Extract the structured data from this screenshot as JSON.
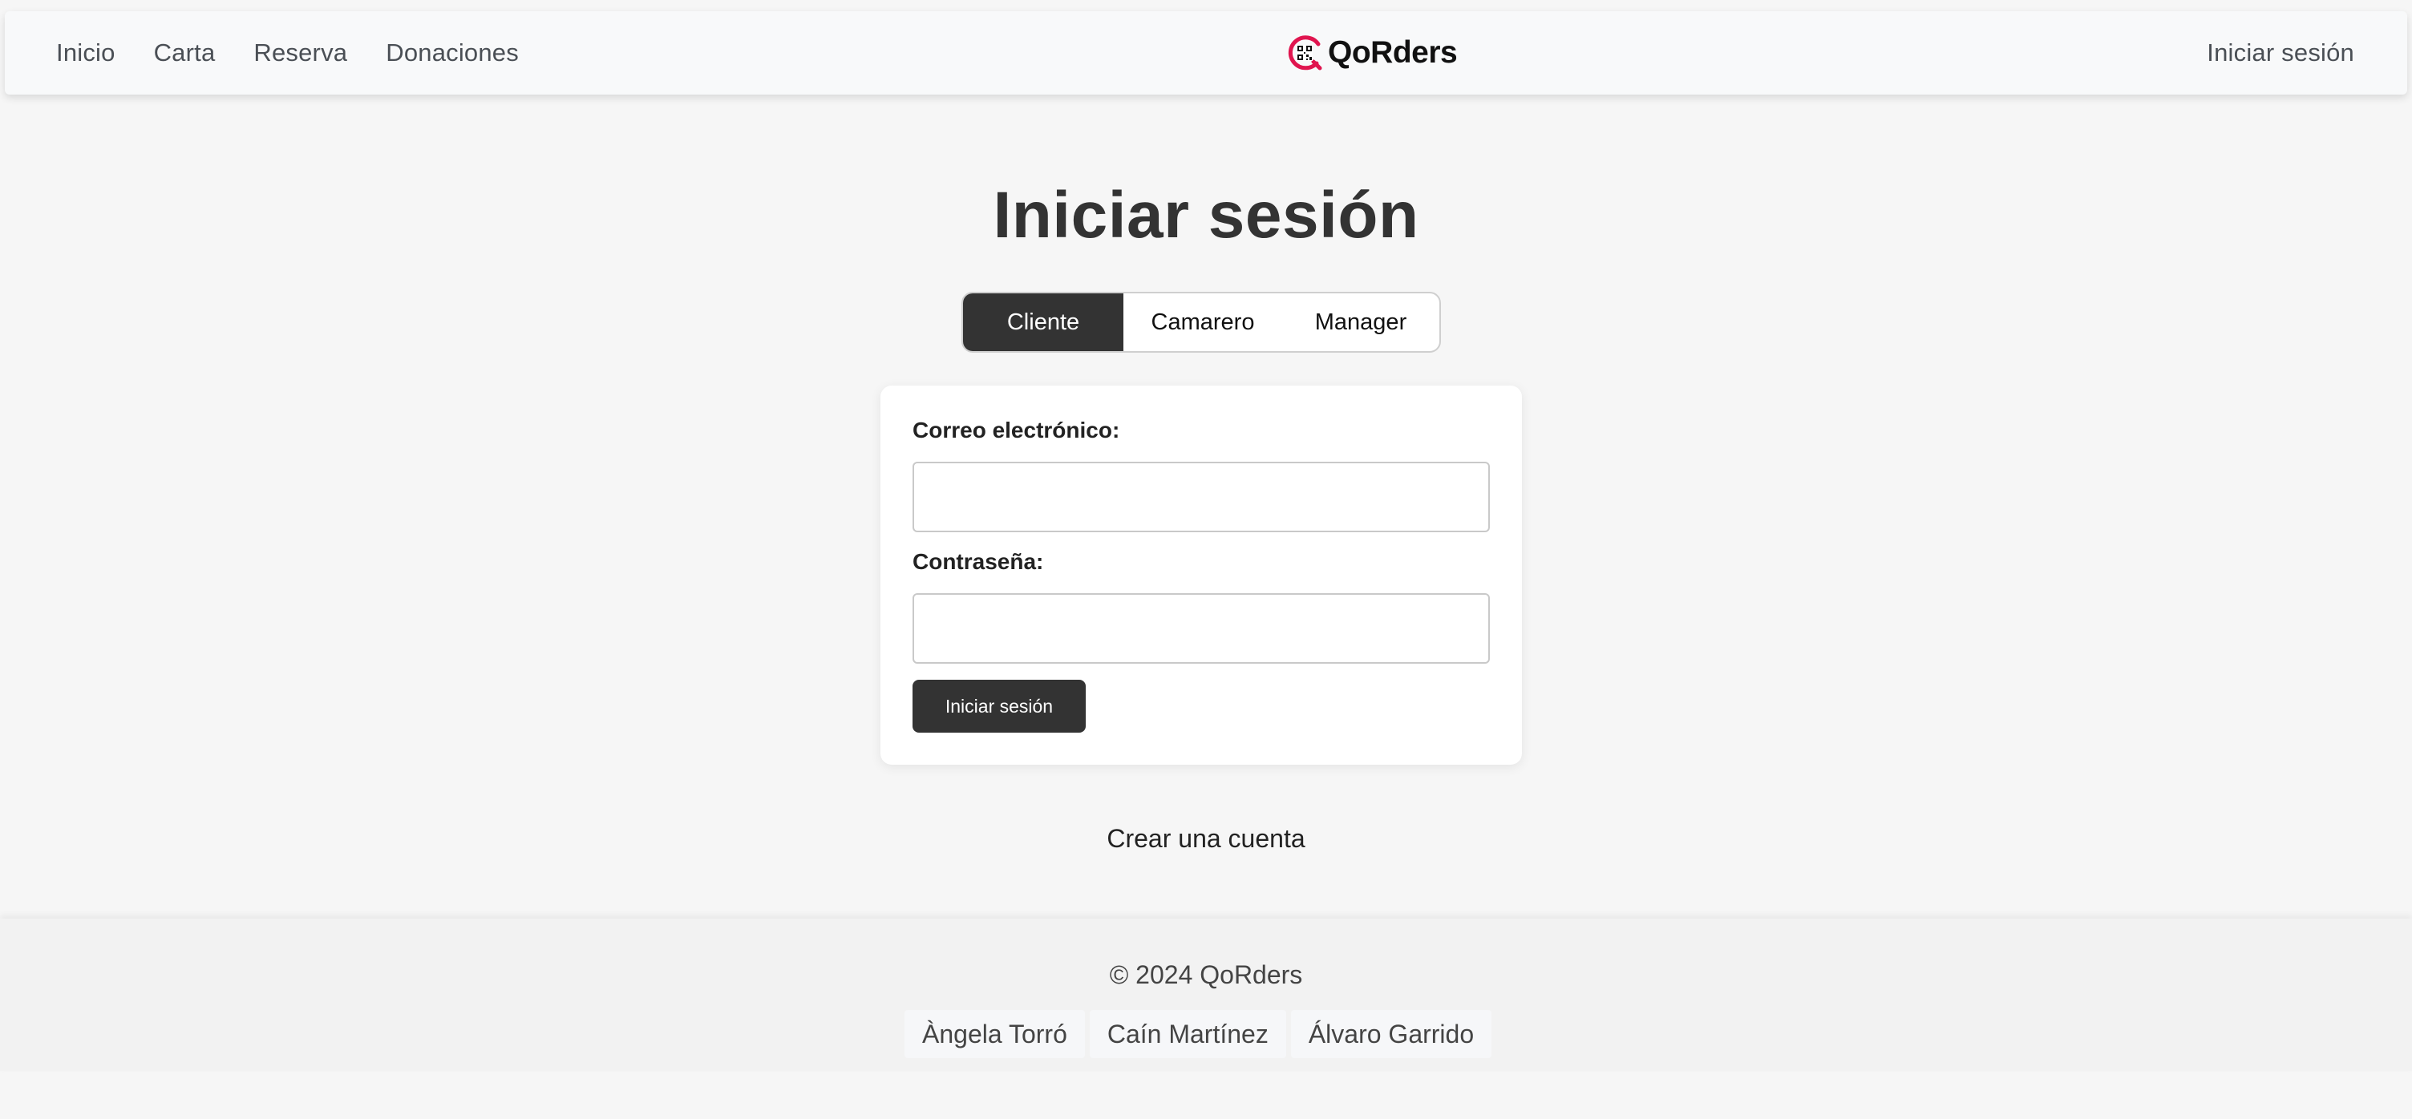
{
  "navbar": {
    "links": [
      "Inicio",
      "Carta",
      "Reserva",
      "Donaciones"
    ],
    "brand_name": "QoRders",
    "brand_icon": "qr-code-logo-icon",
    "login_link": "Iniciar sesión"
  },
  "main": {
    "title": "Iniciar sesión",
    "role_tabs": [
      {
        "label": "Cliente",
        "active": true
      },
      {
        "label": "Camarero",
        "active": false
      },
      {
        "label": "Manager",
        "active": false
      }
    ],
    "form": {
      "email_label": "Correo electrónico:",
      "email_value": "",
      "password_label": "Contraseña:",
      "password_value": "",
      "submit_label": "Iniciar sesión"
    },
    "create_account": "Crear una cuenta"
  },
  "footer": {
    "copyright": "© 2024 QoRders",
    "authors": [
      "Àngela Torró",
      "Caín Martínez",
      "Álvaro Garrido"
    ]
  },
  "colors": {
    "page_bg": "#f6f6f6",
    "dark": "#333333",
    "brand_accent": "#e0154f"
  }
}
